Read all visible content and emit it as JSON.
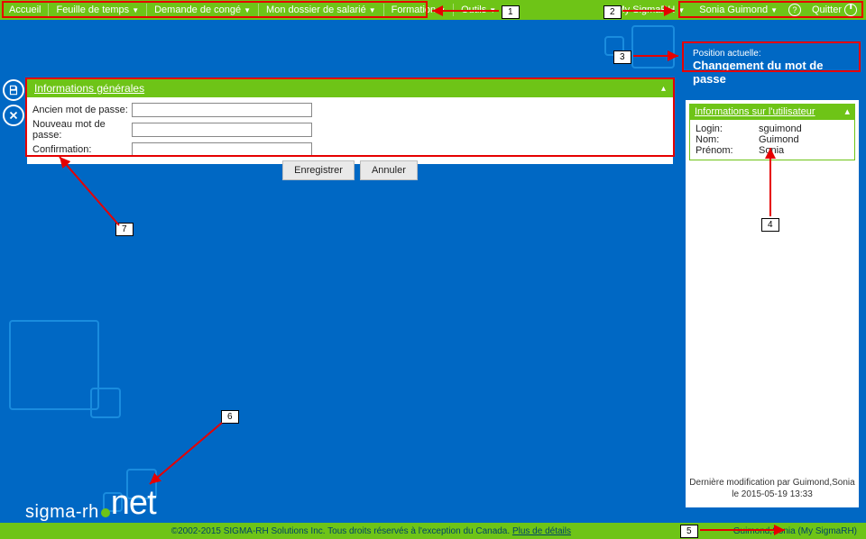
{
  "nav": {
    "left": [
      "Accueil",
      "Feuille de temps",
      "Demande de congé",
      "Mon dossier de salarié",
      "Formation",
      "Outils"
    ],
    "product": "My SigmaRH",
    "user": "Sonia Guimond",
    "quit": "Quitter"
  },
  "position": {
    "label": "Position actuelle:",
    "value": "Changement du mot de passe"
  },
  "form": {
    "title": "Informations générales",
    "old": "Ancien mot de passe:",
    "new": "Nouveau mot de passe:",
    "confirm": "Confirmation:",
    "save": "Enregistrer",
    "cancel": "Annuler"
  },
  "userinfo": {
    "title": "Informations sur l'utilisateur",
    "login_k": "Login:",
    "login_v": "sguimond",
    "nom_k": "Nom:",
    "nom_v": "Guimond",
    "prenom_k": "Prénom:",
    "prenom_v": "Sonia"
  },
  "lastmod": {
    "line1": "Dernière modification par Guimond,Sonia",
    "line2": "le 2015-05-19 13:33"
  },
  "footer": {
    "copyright": "©2002-2015 SIGMA-RH Solutions Inc. Tous droits réservés à l'exception du Canada.",
    "details": "Plus de détails",
    "context": "Guimond,Sonia (My SigmaRH)"
  },
  "logo": {
    "sigma": "sigma-rh",
    "net": "net"
  },
  "callouts": {
    "c1": "1",
    "c2": "2",
    "c3": "3",
    "c4": "4",
    "c5": "5",
    "c6": "6",
    "c7": "7"
  }
}
